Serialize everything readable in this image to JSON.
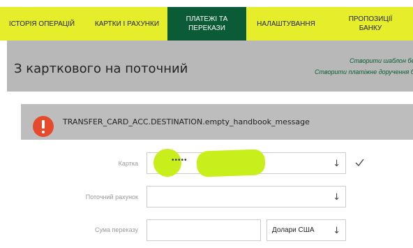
{
  "nav": {
    "items": [
      {
        "label": "ІСТОРІЯ ОПЕРАЦІЙ"
      },
      {
        "label": "КАРТКИ І РАХУНКИ"
      },
      {
        "label": "ПЛАТЕЖІ ТА ПЕРЕКАЗИ"
      },
      {
        "label": "НАЛАШТУВАННЯ"
      },
      {
        "label": "ПРОПОЗИЦІЇ БАНКУ"
      }
    ],
    "active_index": 2
  },
  "header": {
    "title": "З карткового на поточний",
    "links": [
      {
        "label": "Створити шаблон без"
      },
      {
        "label": "Створити платіжне доручення без"
      }
    ]
  },
  "alert": {
    "icon": "exclamation-icon",
    "message": "TRANSFER_CARD_ACC.DESTINATION.empty_handbook_message"
  },
  "form": {
    "card": {
      "label": "Картка",
      "masked_value": "•••••"
    },
    "account": {
      "label": "Поточний рахунок",
      "value": ""
    },
    "amount": {
      "label": "Сума переказу",
      "value": ""
    },
    "currency": {
      "value": "Долари США"
    },
    "dropdown_glyph": "↓"
  },
  "colors": {
    "nav_bg": "#e6ee2b",
    "nav_active_bg": "#0a5b36",
    "header_bg": "#b8b8b8",
    "alert_bg": "#bdbdbd",
    "error": "#e64a2c",
    "redaction": "#c8ee1c"
  }
}
